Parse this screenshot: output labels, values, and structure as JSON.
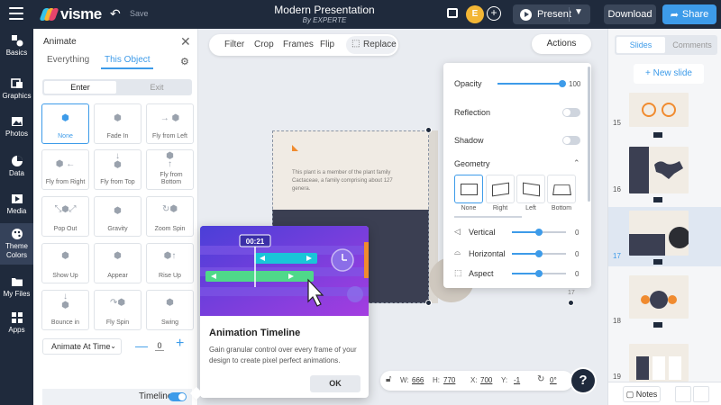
{
  "topbar": {
    "brand": "visme",
    "save_label": "Save",
    "doc_title": "Modern Presentation",
    "doc_subtitle": "By EXPERTE",
    "avatar_initial": "E",
    "present_label": "Present",
    "download_label": "Download",
    "share_label": "Share"
  },
  "leftnav": [
    {
      "label": "Basics",
      "icon": "shapes-icon"
    },
    {
      "label": "Graphics",
      "icon": "graphics-icon"
    },
    {
      "label": "Photos",
      "icon": "photo-icon"
    },
    {
      "label": "Data",
      "icon": "pie-chart-icon"
    },
    {
      "label": "Media",
      "icon": "media-icon"
    },
    {
      "label": "Theme Colors",
      "icon": "palette-icon"
    },
    {
      "label": "My Files",
      "icon": "folder-icon"
    },
    {
      "label": "Apps",
      "icon": "apps-icon"
    }
  ],
  "animate": {
    "title": "Animate",
    "tab_everything": "Everything",
    "tab_this_object": "This Object",
    "enter_label": "Enter",
    "exit_label": "Exit",
    "items": [
      {
        "label": "None",
        "selected": true
      },
      {
        "label": "Fade In"
      },
      {
        "label": "Fly from Left"
      },
      {
        "label": "Fly from Right"
      },
      {
        "label": "Fly from Top"
      },
      {
        "label": "Fly from Bottom"
      },
      {
        "label": "Pop Out"
      },
      {
        "label": "Gravity"
      },
      {
        "label": "Zoom Spin"
      },
      {
        "label": "Show Up"
      },
      {
        "label": "Appear"
      },
      {
        "label": "Rise Up"
      },
      {
        "label": "Bounce in"
      },
      {
        "label": "Fly Spin"
      },
      {
        "label": "Swing"
      }
    ],
    "time_option": "Animate At Time",
    "time_value": "0",
    "timeline_label": "Timeline"
  },
  "toolbar": {
    "filter": "Filter",
    "crop": "Crop",
    "frames": "Frames",
    "flip": "Flip",
    "replace": "Replace",
    "actions": "Actions"
  },
  "slide": {
    "body_text": "This plant is a member of the plant family Cactaceae, a family comprising about 127 genera.",
    "page_number": "17"
  },
  "actions_panel": {
    "opacity_label": "Opacity",
    "opacity_value": "100",
    "reflection_label": "Reflection",
    "shadow_label": "Shadow",
    "geometry_label": "Geometry",
    "geometry_options": [
      "None",
      "Right",
      "Left",
      "Bottom"
    ],
    "vertical_label": "Vertical",
    "vertical_value": "0",
    "horizontal_label": "Horizontal",
    "horizontal_value": "0",
    "aspect_label": "Aspect",
    "aspect_value": "0"
  },
  "popup": {
    "time_badge": "00:21",
    "title": "Animation Timeline",
    "body": "Gain granular control over every frame of your design to create pixel perfect animations.",
    "ok_label": "OK"
  },
  "props": {
    "w_label": "W:",
    "w_value": "666",
    "h_label": "H:",
    "h_value": "770",
    "x_label": "X:",
    "x_value": "700",
    "y_label": "Y:",
    "y_value": "-1",
    "rotation_value": "0°"
  },
  "right_panel": {
    "tab_slides": "Slides",
    "tab_comments": "Comments",
    "new_slide_label": "+ New slide",
    "slides": [
      {
        "number": "15"
      },
      {
        "number": "16"
      },
      {
        "number": "17",
        "active": true
      },
      {
        "number": "18"
      },
      {
        "number": "19"
      }
    ],
    "notes_label": "Notes"
  },
  "colors": {
    "nav_bg": "#1f2a3c",
    "accent": "#3d9be9",
    "popup_purple": "#6a3fd8",
    "cyan_bar": "#19c6d8",
    "green_bar": "#4fd88a"
  }
}
